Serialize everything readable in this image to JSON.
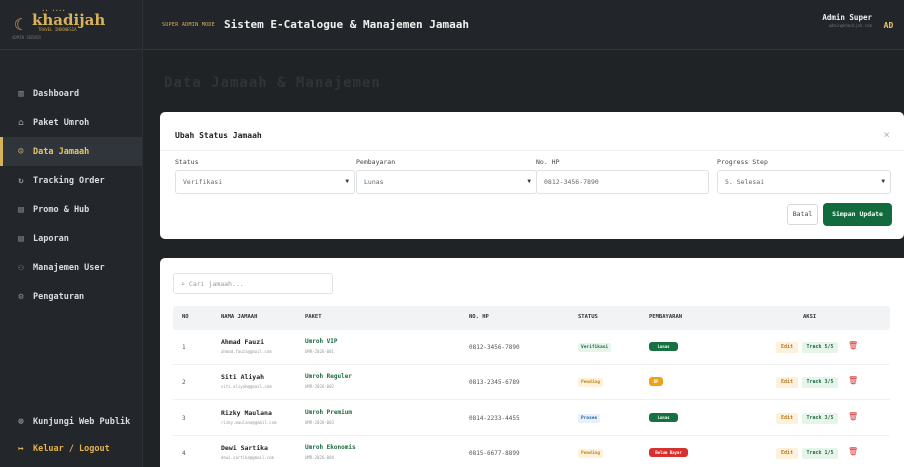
{
  "brand": {
    "pre": "•• ••••",
    "name": "khadijah",
    "sub": "TRAVEL INDONESIA",
    "role": "ADMIN SERVER"
  },
  "sidebar": {
    "items": [
      {
        "label": "Dashboard",
        "icon": "chart-icon"
      },
      {
        "label": "Paket Umroh",
        "icon": "kaaba-icon"
      },
      {
        "label": "Data Jamaah",
        "icon": "users-icon",
        "active": true
      },
      {
        "label": "Tracking Order",
        "icon": "refresh-icon"
      },
      {
        "label": "Promo & Hub",
        "icon": "tag-icon"
      },
      {
        "label": "Laporan",
        "icon": "document-icon"
      },
      {
        "label": "Manajemen User",
        "icon": "user-gear-icon"
      },
      {
        "label": "Pengaturan",
        "icon": "gear-icon"
      }
    ],
    "footer": [
      {
        "label": "Kunjungi Web Publik",
        "icon": "globe-icon"
      },
      {
        "label": "Keluar / Logout",
        "icon": "logout-icon"
      }
    ]
  },
  "header": {
    "mode": "SUPER ADMIN MODE",
    "title": "Sistem E-Catalogue & Manajemen Jamaah",
    "user_name": "Admin Super",
    "user_email": "admin@khadijah.com",
    "avatar": "AD"
  },
  "page": {
    "heading": "Data Jamaah & Manajemen"
  },
  "modal": {
    "title": "Ubah Status Jamaah",
    "close": "×",
    "fields": [
      {
        "label": "Status",
        "value": "Verifikasi",
        "select": true
      },
      {
        "label": "Pembayaran",
        "value": "Lunas",
        "select": true
      },
      {
        "label": "No. HP",
        "value": "0812-3456-7890",
        "select": false
      },
      {
        "label": "Progress Step",
        "value": "5. Selesai",
        "select": true
      }
    ],
    "cancel": "Batal",
    "save": "Simpan Update"
  },
  "table": {
    "search_placeholder": "Cari jamaah...",
    "headers": [
      "NO",
      "NAMA JAMAAH",
      "PAKET",
      "NO. HP",
      "STATUS",
      "PEMBAYARAN",
      "AKSI"
    ],
    "rows": [
      {
        "no": "1",
        "name": "Ahmad Fauzi",
        "email": "ahmad.fauzi@gmail.com",
        "paket": "Umroh VIP",
        "code": "UMR-2026-001",
        "hp": "0812-3456-7890",
        "status": "Verifikasi",
        "status_class": "verif",
        "pay": "Lunas",
        "pay_class": "lunas",
        "edit": "Edit",
        "track": "Track 5/5"
      },
      {
        "no": "2",
        "name": "Siti Aliyah",
        "email": "siti.aliyah@gmail.com",
        "paket": "Umroh Reguler",
        "code": "UMR-2026-002",
        "hp": "0813-2345-6789",
        "status": "Pending",
        "status_class": "pend",
        "pay": "DP",
        "pay_class": "dp",
        "edit": "Edit",
        "track": "Track 3/5"
      },
      {
        "no": "3",
        "name": "Rizky Maulana",
        "email": "rizky.maulana@gmail.com",
        "paket": "Umroh Premium",
        "code": "UMR-2026-003",
        "hp": "0814-2233-4455",
        "status": "Proses",
        "status_class": "pros",
        "pay": "Lunas",
        "pay_class": "lunas",
        "edit": "Edit",
        "track": "Track 3/5"
      },
      {
        "no": "4",
        "name": "Dewi Sartika",
        "email": "dewi.sartika@gmail.com",
        "paket": "Umroh Ekonomis",
        "code": "UMR-2026-004",
        "hp": "0815-6677-8899",
        "status": "Pending",
        "status_class": "pend",
        "pay": "Belum Bayar",
        "pay_class": "belum",
        "edit": "Edit",
        "track": "Track 1/5"
      }
    ]
  }
}
